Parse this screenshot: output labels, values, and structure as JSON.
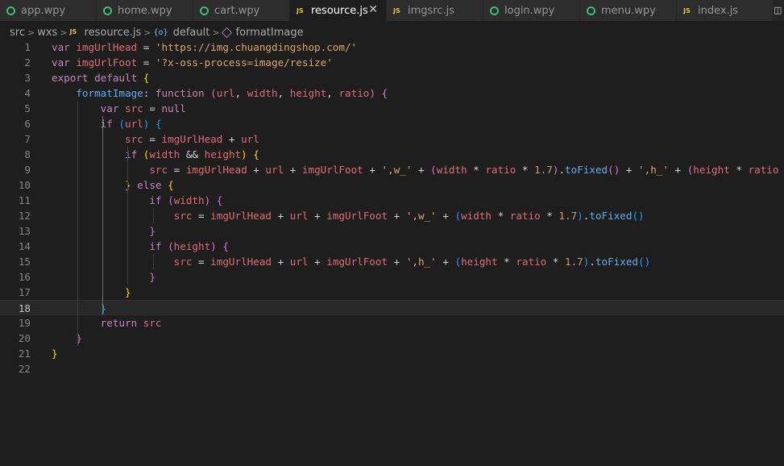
{
  "tabs": [
    {
      "label": "app.wpy",
      "icon": "wpy-icon",
      "active": false
    },
    {
      "label": "home.wpy",
      "icon": "wpy-icon",
      "active": false
    },
    {
      "label": "cart.wpy",
      "icon": "wpy-icon",
      "active": false
    },
    {
      "label": "resource.js",
      "icon": "js-icon",
      "active": true,
      "close": "✕"
    },
    {
      "label": "imgsrc.js",
      "icon": "js-icon",
      "active": false
    },
    {
      "label": "login.wpy",
      "icon": "wpy-icon",
      "active": false
    },
    {
      "label": "menu.wpy",
      "icon": "wpy-icon",
      "active": false
    },
    {
      "label": "index.js",
      "icon": "js-icon",
      "active": false
    }
  ],
  "icon_text": {
    "js": "JS"
  },
  "breadcrumb": {
    "items": [
      "src",
      "wxs",
      "resource.js",
      "default",
      "formatImage"
    ],
    "separator": ">"
  },
  "editor": {
    "current_line": 18,
    "lines": [
      {
        "n": "1",
        "tokens": [
          [
            "kw",
            "var "
          ],
          [
            "vr",
            "imgUrlHead"
          ],
          [
            "op",
            " = "
          ],
          [
            "st",
            "'https://img.chuangdingshop.com/'"
          ]
        ]
      },
      {
        "n": "2",
        "tokens": [
          [
            "kw",
            "var "
          ],
          [
            "vr",
            "imgUrlFoot"
          ],
          [
            "op",
            " = "
          ],
          [
            "st",
            "'?x-oss-process=image/resize'"
          ]
        ]
      },
      {
        "n": "3",
        "tokens": [
          [
            "kw",
            "export default "
          ],
          [
            "b1",
            "{"
          ]
        ]
      },
      {
        "n": "4",
        "tokens": [
          [
            "tx",
            "    "
          ],
          [
            "fn",
            "formatImage"
          ],
          [
            "op",
            ": "
          ],
          [
            "kw",
            "function "
          ],
          [
            "b2",
            "("
          ],
          [
            "vr",
            "url"
          ],
          [
            "op",
            ", "
          ],
          [
            "vr",
            "width"
          ],
          [
            "op",
            ", "
          ],
          [
            "vr",
            "height"
          ],
          [
            "op",
            ", "
          ],
          [
            "vr",
            "ratio"
          ],
          [
            "b2",
            ")"
          ],
          [
            "op",
            " "
          ],
          [
            "b2",
            "{"
          ]
        ]
      },
      {
        "n": "5",
        "tokens": [
          [
            "tx",
            "        "
          ],
          [
            "kw",
            "var "
          ],
          [
            "vr",
            "src"
          ],
          [
            "op",
            " = "
          ],
          [
            "kw",
            "null"
          ]
        ]
      },
      {
        "n": "6",
        "tokens": [
          [
            "tx",
            "        "
          ],
          [
            "kw",
            "if "
          ],
          [
            "b3",
            "("
          ],
          [
            "vr",
            "url"
          ],
          [
            "b3",
            ")"
          ],
          [
            "op",
            " "
          ],
          [
            "b3",
            "{"
          ]
        ]
      },
      {
        "n": "7",
        "tokens": [
          [
            "tx",
            "            "
          ],
          [
            "vr",
            "src"
          ],
          [
            "op",
            " = "
          ],
          [
            "vr",
            "imgUrlHead"
          ],
          [
            "op",
            " + "
          ],
          [
            "vr",
            "url"
          ]
        ]
      },
      {
        "n": "8",
        "tokens": [
          [
            "tx",
            "            "
          ],
          [
            "kw",
            "if "
          ],
          [
            "b1",
            "("
          ],
          [
            "vr",
            "width"
          ],
          [
            "op",
            " && "
          ],
          [
            "vr",
            "height"
          ],
          [
            "b1",
            ")"
          ],
          [
            "op",
            " "
          ],
          [
            "b1",
            "{"
          ]
        ]
      },
      {
        "n": "9",
        "tokens": [
          [
            "tx",
            "                "
          ],
          [
            "vr",
            "src"
          ],
          [
            "op",
            " = "
          ],
          [
            "vr",
            "imgUrlHead"
          ],
          [
            "op",
            " + "
          ],
          [
            "vr",
            "url"
          ],
          [
            "op",
            " + "
          ],
          [
            "vr",
            "imgUrlFoot"
          ],
          [
            "op",
            " + "
          ],
          [
            "st",
            "',w_'"
          ],
          [
            "op",
            " + "
          ],
          [
            "b2",
            "("
          ],
          [
            "vr",
            "width"
          ],
          [
            "op",
            " * "
          ],
          [
            "vr",
            "ratio"
          ],
          [
            "op",
            " * "
          ],
          [
            "nu",
            "1.7"
          ],
          [
            "b2",
            ")"
          ],
          [
            "op",
            "."
          ],
          [
            "fn",
            "toFixed"
          ],
          [
            "b2",
            "()"
          ],
          [
            "op",
            " + "
          ],
          [
            "st",
            "',h_'"
          ],
          [
            "op",
            " + "
          ],
          [
            "b2",
            "("
          ],
          [
            "vr",
            "height"
          ],
          [
            "op",
            " * "
          ],
          [
            "vr",
            "ratio"
          ]
        ]
      },
      {
        "n": "10",
        "tokens": [
          [
            "tx",
            "            "
          ],
          [
            "b1",
            "}"
          ],
          [
            "kw",
            " else "
          ],
          [
            "b1",
            "{"
          ]
        ]
      },
      {
        "n": "11",
        "tokens": [
          [
            "tx",
            "                "
          ],
          [
            "kw",
            "if "
          ],
          [
            "b2",
            "("
          ],
          [
            "vr",
            "width"
          ],
          [
            "b2",
            ")"
          ],
          [
            "op",
            " "
          ],
          [
            "b2",
            "{"
          ]
        ]
      },
      {
        "n": "12",
        "tokens": [
          [
            "tx",
            "                    "
          ],
          [
            "vr",
            "src"
          ],
          [
            "op",
            " = "
          ],
          [
            "vr",
            "imgUrlHead"
          ],
          [
            "op",
            " + "
          ],
          [
            "vr",
            "url"
          ],
          [
            "op",
            " + "
          ],
          [
            "vr",
            "imgUrlFoot"
          ],
          [
            "op",
            " + "
          ],
          [
            "st",
            "',w_'"
          ],
          [
            "op",
            " + "
          ],
          [
            "b3",
            "("
          ],
          [
            "vr",
            "width"
          ],
          [
            "op",
            " * "
          ],
          [
            "vr",
            "ratio"
          ],
          [
            "op",
            " * "
          ],
          [
            "nu",
            "1.7"
          ],
          [
            "b3",
            ")"
          ],
          [
            "op",
            "."
          ],
          [
            "fn",
            "toFixed"
          ],
          [
            "b3",
            "()"
          ]
        ]
      },
      {
        "n": "13",
        "tokens": [
          [
            "tx",
            "                "
          ],
          [
            "b2",
            "}"
          ]
        ]
      },
      {
        "n": "14",
        "tokens": [
          [
            "tx",
            "                "
          ],
          [
            "kw",
            "if "
          ],
          [
            "b2",
            "("
          ],
          [
            "vr",
            "height"
          ],
          [
            "b2",
            ")"
          ],
          [
            "op",
            " "
          ],
          [
            "b2",
            "{"
          ]
        ]
      },
      {
        "n": "15",
        "tokens": [
          [
            "tx",
            "                    "
          ],
          [
            "vr",
            "src"
          ],
          [
            "op",
            " = "
          ],
          [
            "vr",
            "imgUrlHead"
          ],
          [
            "op",
            " + "
          ],
          [
            "vr",
            "url"
          ],
          [
            "op",
            " + "
          ],
          [
            "vr",
            "imgUrlFoot"
          ],
          [
            "op",
            " + "
          ],
          [
            "st",
            "',h_'"
          ],
          [
            "op",
            " + "
          ],
          [
            "b3",
            "("
          ],
          [
            "vr",
            "height"
          ],
          [
            "op",
            " * "
          ],
          [
            "vr",
            "ratio"
          ],
          [
            "op",
            " * "
          ],
          [
            "nu",
            "1.7"
          ],
          [
            "b3",
            ")"
          ],
          [
            "op",
            "."
          ],
          [
            "fn",
            "toFixed"
          ],
          [
            "b3",
            "()"
          ]
        ]
      },
      {
        "n": "16",
        "tokens": [
          [
            "tx",
            "                "
          ],
          [
            "b2",
            "}"
          ]
        ]
      },
      {
        "n": "17",
        "tokens": [
          [
            "tx",
            "            "
          ],
          [
            "b1",
            "}"
          ]
        ]
      },
      {
        "n": "18",
        "tokens": [
          [
            "tx",
            "        "
          ],
          [
            "b3",
            "}"
          ]
        ]
      },
      {
        "n": "19",
        "tokens": [
          [
            "tx",
            "        "
          ],
          [
            "kw",
            "return "
          ],
          [
            "vr",
            "src"
          ]
        ]
      },
      {
        "n": "20",
        "tokens": [
          [
            "tx",
            "    "
          ],
          [
            "b2",
            "}"
          ]
        ]
      },
      {
        "n": "21",
        "tokens": [
          [
            "b1",
            "}"
          ]
        ]
      },
      {
        "n": "22",
        "tokens": []
      }
    ]
  },
  "colors": {
    "background": "#1e1e1e",
    "keyword": "#c586c0",
    "string": "#dfa46a",
    "function": "#61afef",
    "variable": "#e06c75"
  }
}
